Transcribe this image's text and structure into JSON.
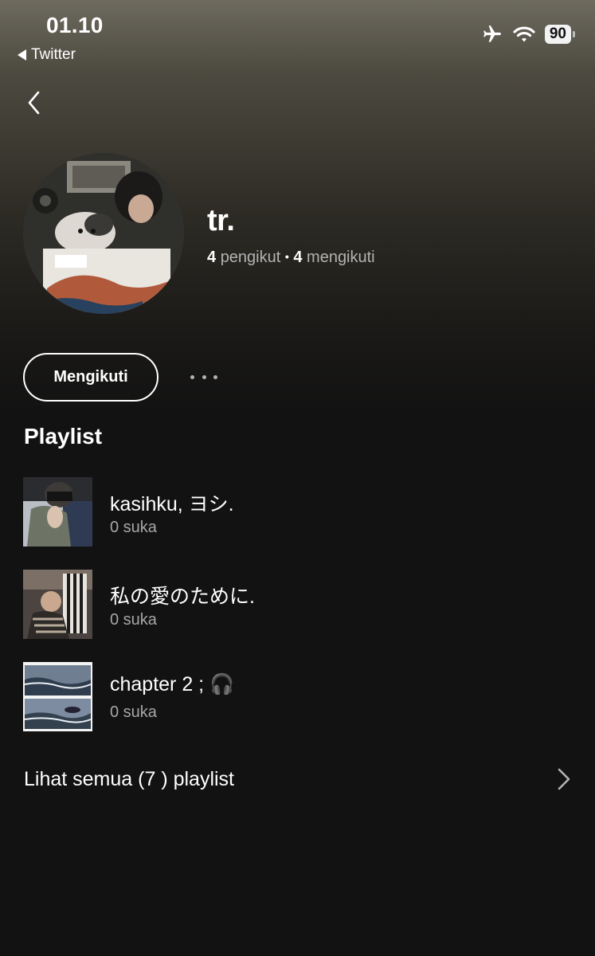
{
  "status_bar": {
    "time": "01.10",
    "back_app": "Twitter",
    "battery": "90",
    "icons": [
      "airplane-icon",
      "wifi-icon",
      "battery-icon"
    ]
  },
  "profile": {
    "name": "tr.",
    "followers_count": "4",
    "followers_label": "pengikut",
    "separator": "•",
    "following_count": "4",
    "following_label": "mengikuti"
  },
  "actions": {
    "follow_label": "Mengikuti",
    "more_icon": "more-dots-icon"
  },
  "section_title": "Playlist",
  "playlists": [
    {
      "name": "kasihku, ヨシ.",
      "likes": "0 suka"
    },
    {
      "name": "私の愛のために.",
      "likes": "0 suka"
    },
    {
      "name": "chapter 2 ; 🎧",
      "likes": "0 suka"
    }
  ],
  "see_all": {
    "label": "Lihat semua (7 ) playlist",
    "icon": "chevron-right-icon"
  },
  "colors": {
    "background": "#121212",
    "secondary_text": "#b3b3b3",
    "primary_text": "#ffffff"
  }
}
